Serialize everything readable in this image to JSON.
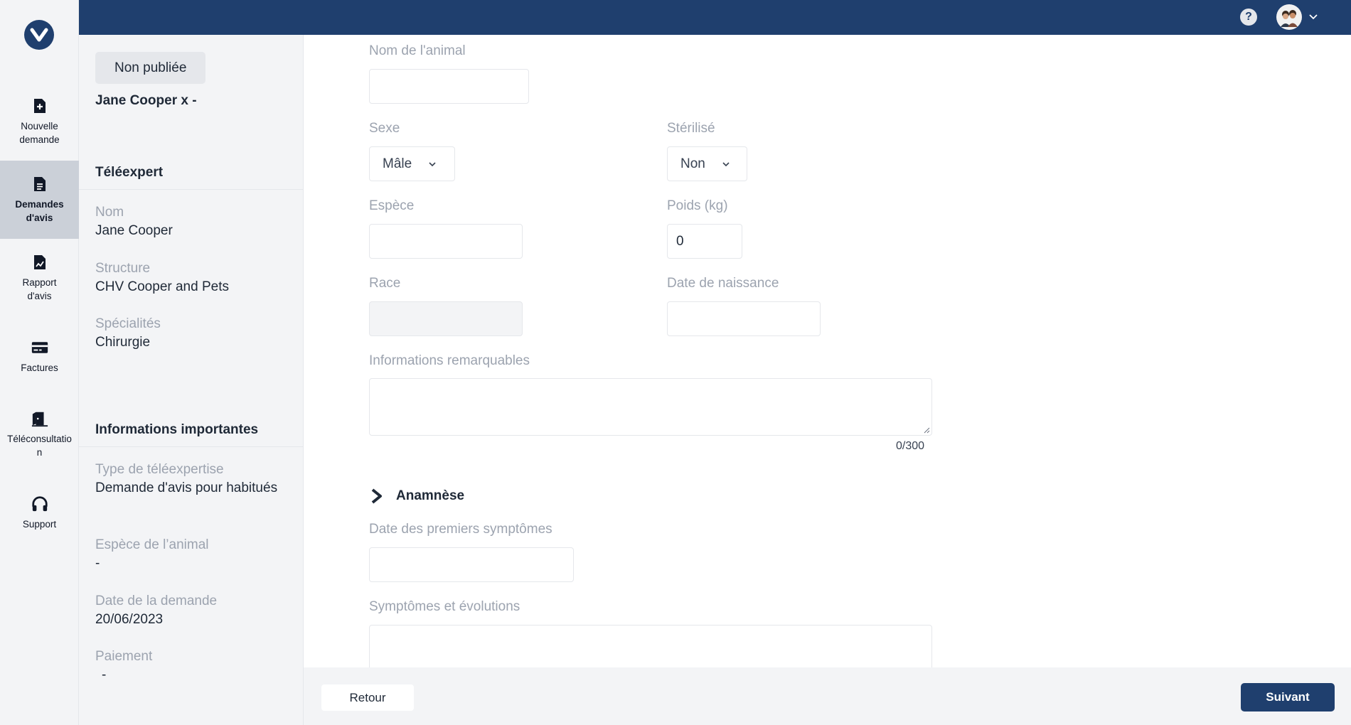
{
  "nav": {
    "items": [
      {
        "label": "Nouvelle demande"
      },
      {
        "label": "Demandes d'avis"
      },
      {
        "label": "Rapport d'avis"
      },
      {
        "label": "Factures"
      },
      {
        "label": "Téléconsultation"
      },
      {
        "label": "Support"
      }
    ]
  },
  "topbar": {
    "help_label": "?"
  },
  "info": {
    "status_badge": "Non publiée",
    "patient_title": "Jane Cooper x -",
    "teleexpert_title": "Téléexpert",
    "nom_label": "Nom",
    "nom_value": "Jane Cooper",
    "structure_label": "Structure",
    "structure_value": "CHV Cooper and Pets",
    "specialites_label": "Spécialités",
    "specialites_value": "Chirurgie",
    "important_title": "Informations importantes",
    "type_label": "Type de téléexpertise",
    "type_value": "Demande d'avis pour habitués",
    "espece_label": "Espèce de l’animal",
    "espece_value": "-",
    "date_label": "Date de la demande",
    "date_value": "20/06/2023",
    "paiement_label": "Paiement",
    "paiement_value": "-"
  },
  "form": {
    "nom_animal_label": "Nom de l'animal",
    "nom_animal_value": "",
    "sexe_label": "Sexe",
    "sexe_value": "Mâle",
    "sterilise_label": "Stérilisé",
    "sterilise_value": "Non",
    "espece_label": "Espèce",
    "espece_value": "",
    "poids_label": "Poids (kg)",
    "poids_value": "0",
    "race_label": "Race",
    "race_value": "",
    "naissance_label": "Date de naissance",
    "naissance_value": "",
    "infos_label": "Informations remarquables",
    "infos_counter": "0/300",
    "anamnese_title": "Anamnèse",
    "premiers_label": "Date des premiers symptômes",
    "premiers_value": "",
    "symptomes_label": "Symptômes et évolutions"
  },
  "footer": {
    "back_label": "Retour",
    "next_label": "Suivant"
  },
  "colors": {
    "brand": "#1f3f6e",
    "active_nav": "#cbd0d8",
    "label_gray": "#9ca3af"
  }
}
